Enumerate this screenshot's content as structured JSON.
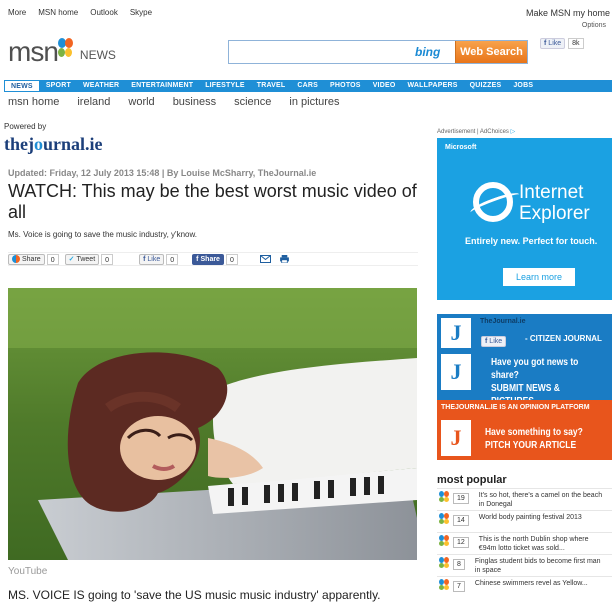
{
  "topbar": {
    "links": [
      "More",
      "MSN home",
      "Outlook",
      "Skype"
    ],
    "make_home": "Make MSN my home",
    "options": "Options"
  },
  "brand": {
    "logo": "msn",
    "section": "NEWS"
  },
  "search": {
    "value": "",
    "engine": "bing",
    "button": "Web Search"
  },
  "fb_top": {
    "like": "Like",
    "count": "8k"
  },
  "nav": {
    "items": [
      "NEWS",
      "SPORT",
      "WEATHER",
      "ENTERTAINMENT",
      "LIFESTYLE",
      "TRAVEL",
      "CARS",
      "PHOTOS",
      "VIDEO",
      "WALLPAPERS",
      "QUIZZES",
      "JOBS"
    ]
  },
  "subnav": {
    "items": [
      "msn home",
      "ireland",
      "world",
      "business",
      "science",
      "in pictures"
    ]
  },
  "powered": {
    "label": "Powered by",
    "logo_a": "thej",
    "logo_dot": "o",
    "logo_b": "urnal.ie"
  },
  "ad": {
    "label": "Advertisement | AdChoices",
    "ie": {
      "maker": "Microsoft",
      "line1": "Internet",
      "line2": "Explorer",
      "tagline": "Entirely new. Perfect for touch.",
      "cta": "Learn more"
    }
  },
  "article": {
    "updated": "Updated: Friday, 12 July 2013 15:48 | By Louise McSharry, TheJournal.ie",
    "headline": "WATCH: This may be the best worst music video of all",
    "lede": "Ms. Voice is going to save the music industry, y'know.",
    "share": {
      "share_label": "Share",
      "share_count": "0",
      "tweet_label": "Tweet",
      "tweet_count": "0",
      "like_label": "Like",
      "like_count": "0",
      "fbshare_label": "Share",
      "fbshare_count": "0"
    },
    "video_source": "YouTube",
    "body": "MS. VOICE IS going to 'save the US music music industry' apparently."
  },
  "cj_ad": {
    "title": "TheJournal.ie",
    "like": "Like",
    "citizen": "- CITIZEN JOURNAL",
    "q1": "Have you got news to share?",
    "q2": "SUBMIT NEWS & PICTURES",
    "band": "THEJOURNAL.IE IS AN OPINION PLATFORM",
    "p1": "Have something to say?",
    "p2": "PITCH YOUR ARTICLE"
  },
  "most_popular": {
    "title": "most popular",
    "items": [
      {
        "count": "19",
        "text": "It's so hot, there's a camel on the beach in Donegal"
      },
      {
        "count": "14",
        "text": "World body painting festival 2013"
      },
      {
        "count": "12",
        "text": "This is the north Dublin shop where €94m lotto ticket was sold..."
      },
      {
        "count": "8",
        "text": "Finglas student bids to become first man in space"
      },
      {
        "count": "7",
        "text": "Chinese swimmers revel as Yellow..."
      }
    ]
  },
  "colors": {
    "msn_blue": "#1f8fd6",
    "bing_orange": "#e8751a",
    "ie_blue": "#1ba1e2",
    "journal_orange": "#e8551c"
  }
}
